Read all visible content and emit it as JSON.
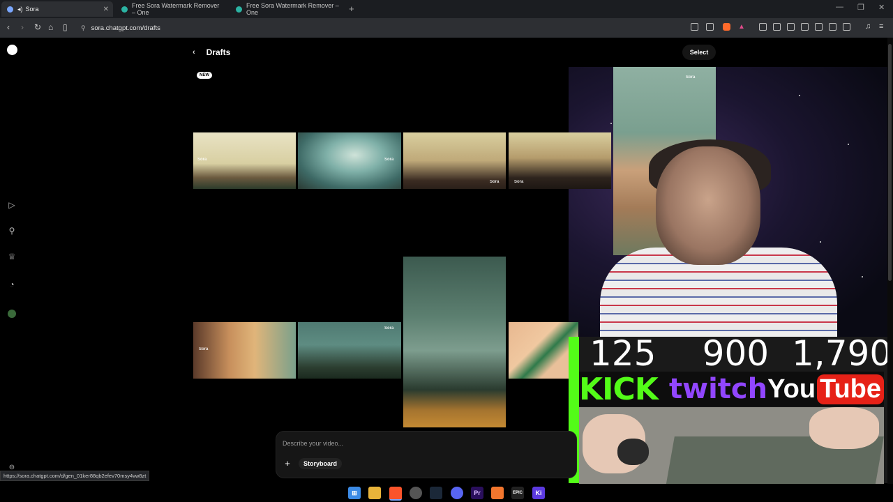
{
  "browser": {
    "tabs": [
      {
        "title": "Sora",
        "active": true
      },
      {
        "title": "Free Sora Watermark Remover – One",
        "active": false
      },
      {
        "title": "Free Sora Watermark Remover – One",
        "active": false
      }
    ],
    "url": "sora.chatgpt.com/drafts",
    "status_url": "https://sora.chatgpt.com/d/gen_01ker88qb2efev70msy4vw8zt"
  },
  "page": {
    "title": "Drafts",
    "select_label": "Select",
    "new_badge": "NEW"
  },
  "sidebar": {
    "icons": [
      "sora-logo-icon",
      "play-icon",
      "search-icon",
      "trophy-icon",
      "bell-icon",
      "avatar-icon"
    ]
  },
  "prompt": {
    "placeholder": "Describe your video...",
    "storyboard_label": "Storyboard",
    "add_label": "+"
  },
  "overlay": {
    "counts": [
      "125",
      "900",
      "1,790"
    ],
    "kick": "KICK",
    "twitch": "twitch",
    "youtube_you": "You",
    "youtube_tube": "Tube"
  },
  "thumb_watermark": "Sora",
  "colors": {
    "accent_kick": "#53fc18",
    "accent_twitch": "#9146ff",
    "accent_youtube": "#e62117"
  }
}
